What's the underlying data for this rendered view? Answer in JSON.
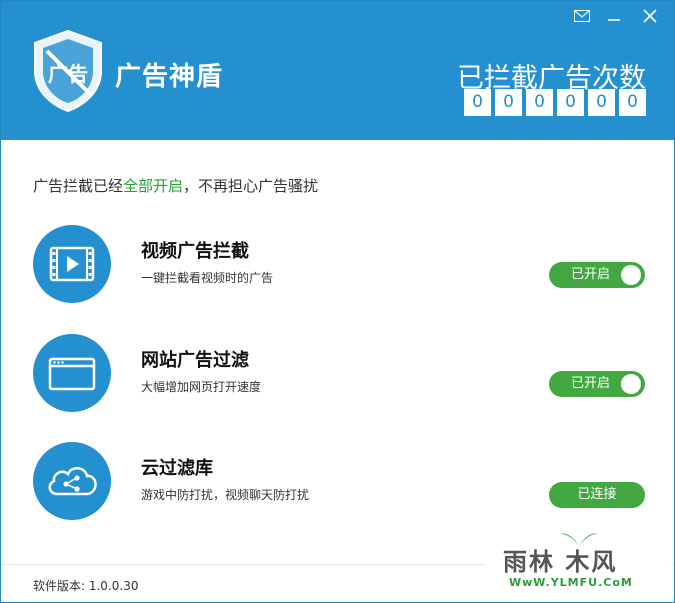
{
  "app": {
    "title": "广告神盾"
  },
  "counter": {
    "label": "已拦截广告次数",
    "digits": [
      "0",
      "0",
      "0",
      "0",
      "0",
      "0"
    ]
  },
  "status": {
    "prefix": "广告拦截已经",
    "highlight": "全部开启",
    "suffix": "，不再担心广告骚扰"
  },
  "features": [
    {
      "title": "视频广告拦截",
      "desc": "一键拦截看视频时的广告",
      "button": "已开启",
      "icon": "video-icon"
    },
    {
      "title": "网站广告过滤",
      "desc": "大幅增加网页打开速度",
      "button": "已开启",
      "icon": "browser-window-icon"
    },
    {
      "title": "云过滤库",
      "desc": "游戏中防打扰，视频聊天防打扰",
      "button": "已连接",
      "icon": "cloud-share-icon"
    }
  ],
  "footer": {
    "version": "软件版本: 1.0.0.30"
  },
  "watermark": {
    "text": "雨林 木风",
    "url": "WwW.YLMFU.CoM"
  },
  "colors": {
    "brand": "#2590cf",
    "toggle": "#43a742",
    "highlight": "#22a033"
  }
}
